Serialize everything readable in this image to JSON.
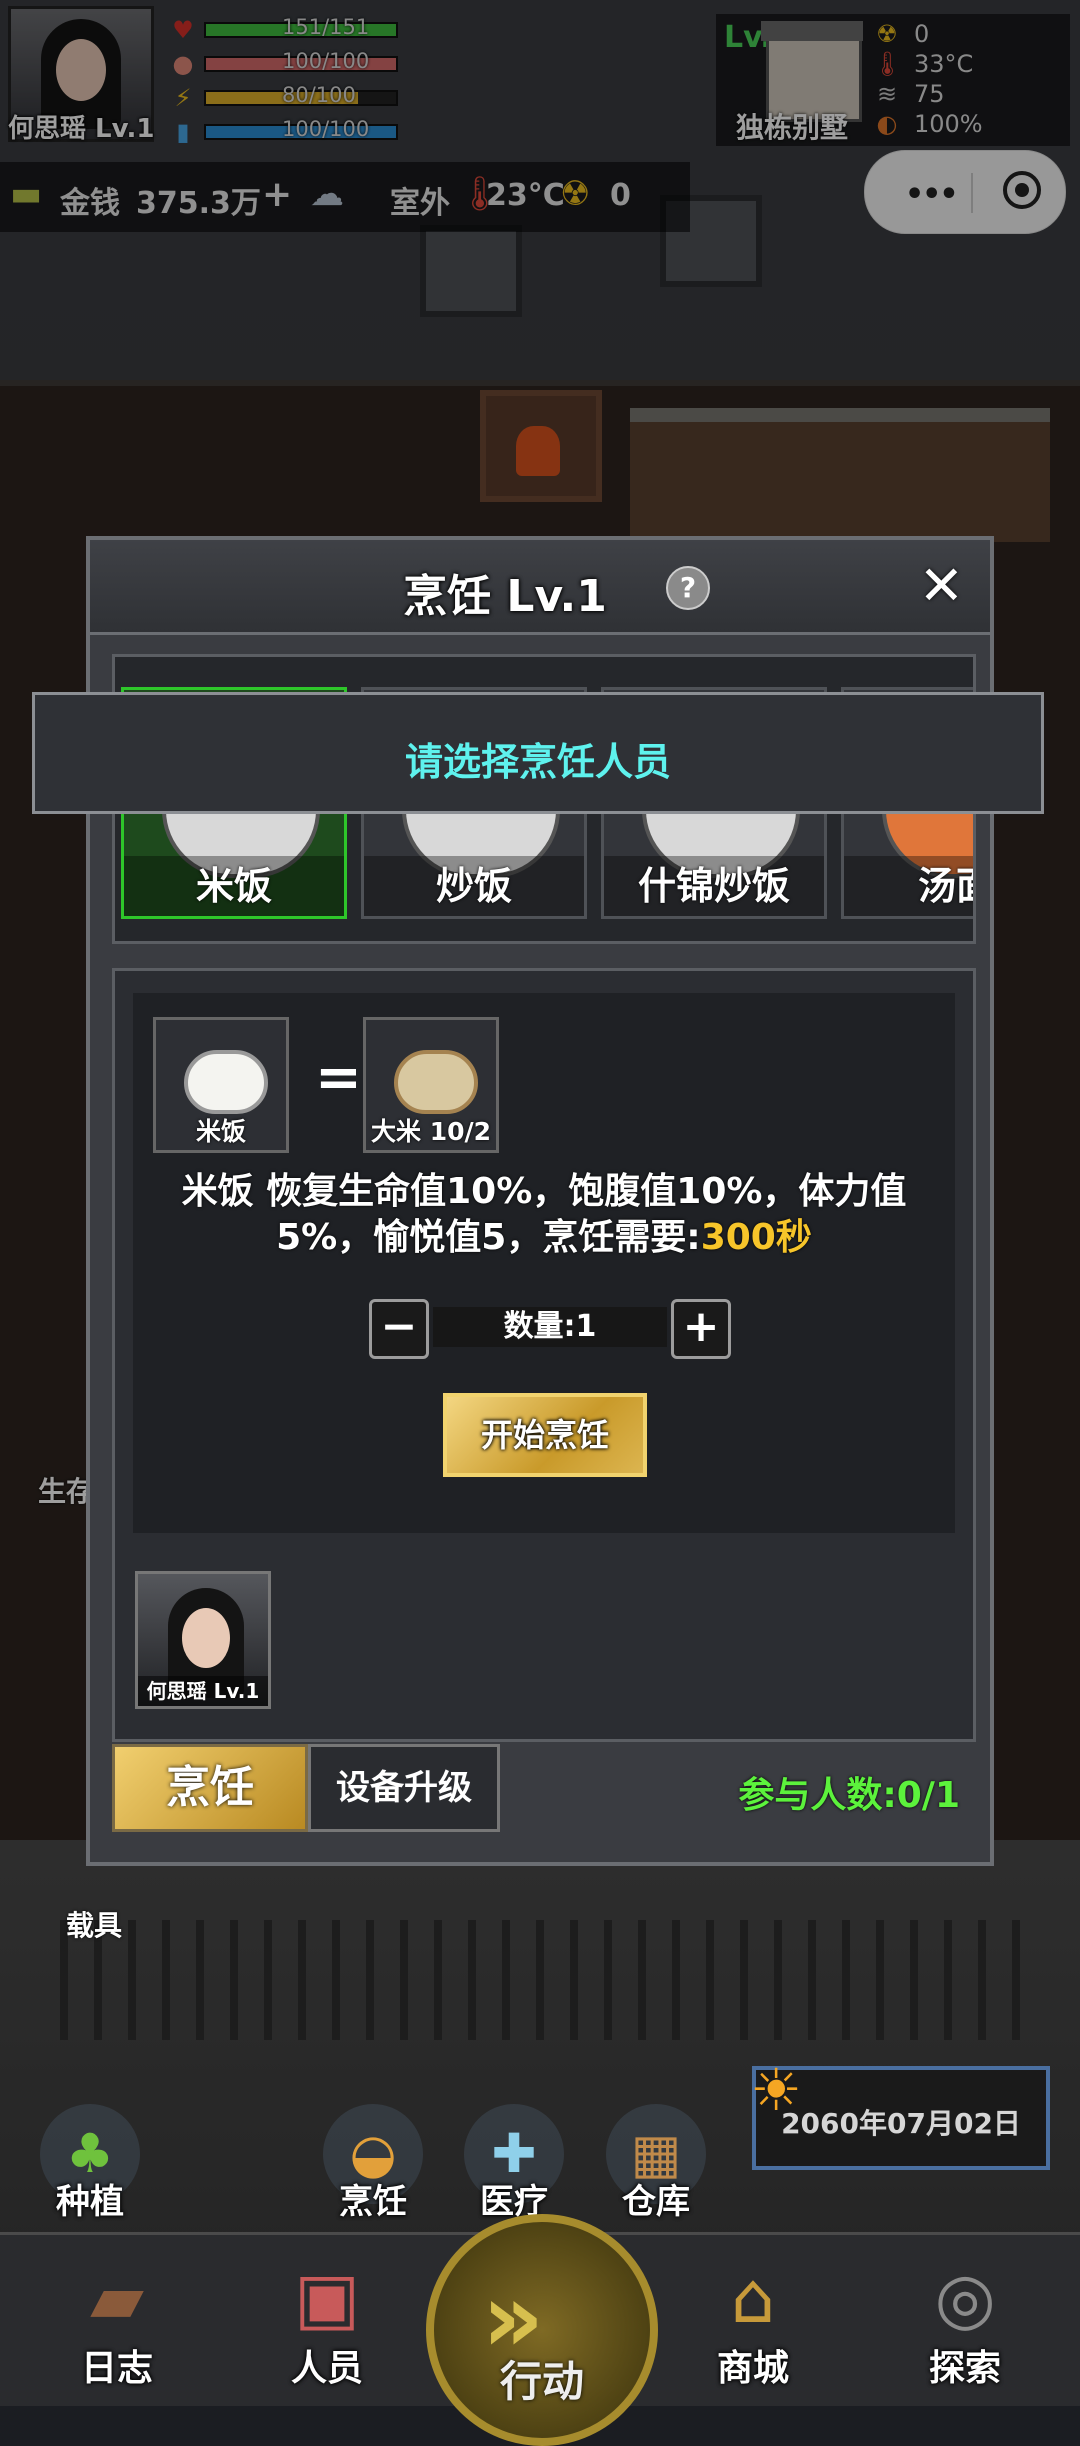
{
  "player": {
    "name": "何思瑶 Lv.1"
  },
  "stats": [
    {
      "icon": "heart-icon",
      "value": "151/151",
      "fill": 1.0,
      "color": "#3fbf3f"
    },
    {
      "icon": "stomach-icon",
      "value": "100/100",
      "fill": 1.0,
      "color": "#d66b6b"
    },
    {
      "icon": "lightning-icon",
      "value": "80/100",
      "fill": 0.8,
      "color": "#e0b22a"
    },
    {
      "icon": "water-icon",
      "value": "100/100",
      "fill": 1.0,
      "color": "#2b8fd6"
    }
  ],
  "resources": {
    "money_label": "金钱",
    "money_value": "375.3万",
    "plus": "+",
    "weather": "室外",
    "temperature": "23°C",
    "radiation": "0"
  },
  "house": {
    "level": "Lv.1",
    "name": "独栋别墅",
    "radiation": "0",
    "temperature": "33°C",
    "stock": "75",
    "condition": "100%"
  },
  "dialog": {
    "title": "烹饪 Lv.1",
    "help": "?",
    "close": "✕",
    "recipes": [
      "米饭",
      "炒饭",
      "什锦炒饭",
      "汤面"
    ],
    "toast": "请选择烹饪人员",
    "output_item": "米饭",
    "equals": "=",
    "input_item": "大米 10/2",
    "description": "米饭 恢复生命值10%，饱腹值10%，体力值5%，愉悦值5，烹饪需要:",
    "time": "300秒",
    "quantity_label": "数量:1",
    "minus": "−",
    "plus": "+",
    "start_button": "开始烹饪",
    "member_name": "何思瑶 Lv.1",
    "tab_cook": "烹饪",
    "tab_upgrade": "设备升级",
    "participants": "参与人数:0/1"
  },
  "side": {
    "survival": "生存",
    "vehicle": "载具"
  },
  "shortcuts": [
    {
      "label": "种植",
      "icon": "sprout-icon"
    },
    {
      "label": "烹饪",
      "icon": "pot-icon"
    },
    {
      "label": "医疗",
      "icon": "medkit-icon"
    },
    {
      "label": "仓库",
      "icon": "crate-icon"
    }
  ],
  "date": "2060年07月02日",
  "nav": {
    "log": "日志",
    "people": "人员",
    "action": "行动",
    "shop": "商城",
    "explore": "探索"
  },
  "colors": {
    "accent_green": "#5cf23c",
    "toast_cyan": "#5ef2ee",
    "time_yellow": "#f7c52a",
    "gold": "#d4a93a"
  }
}
